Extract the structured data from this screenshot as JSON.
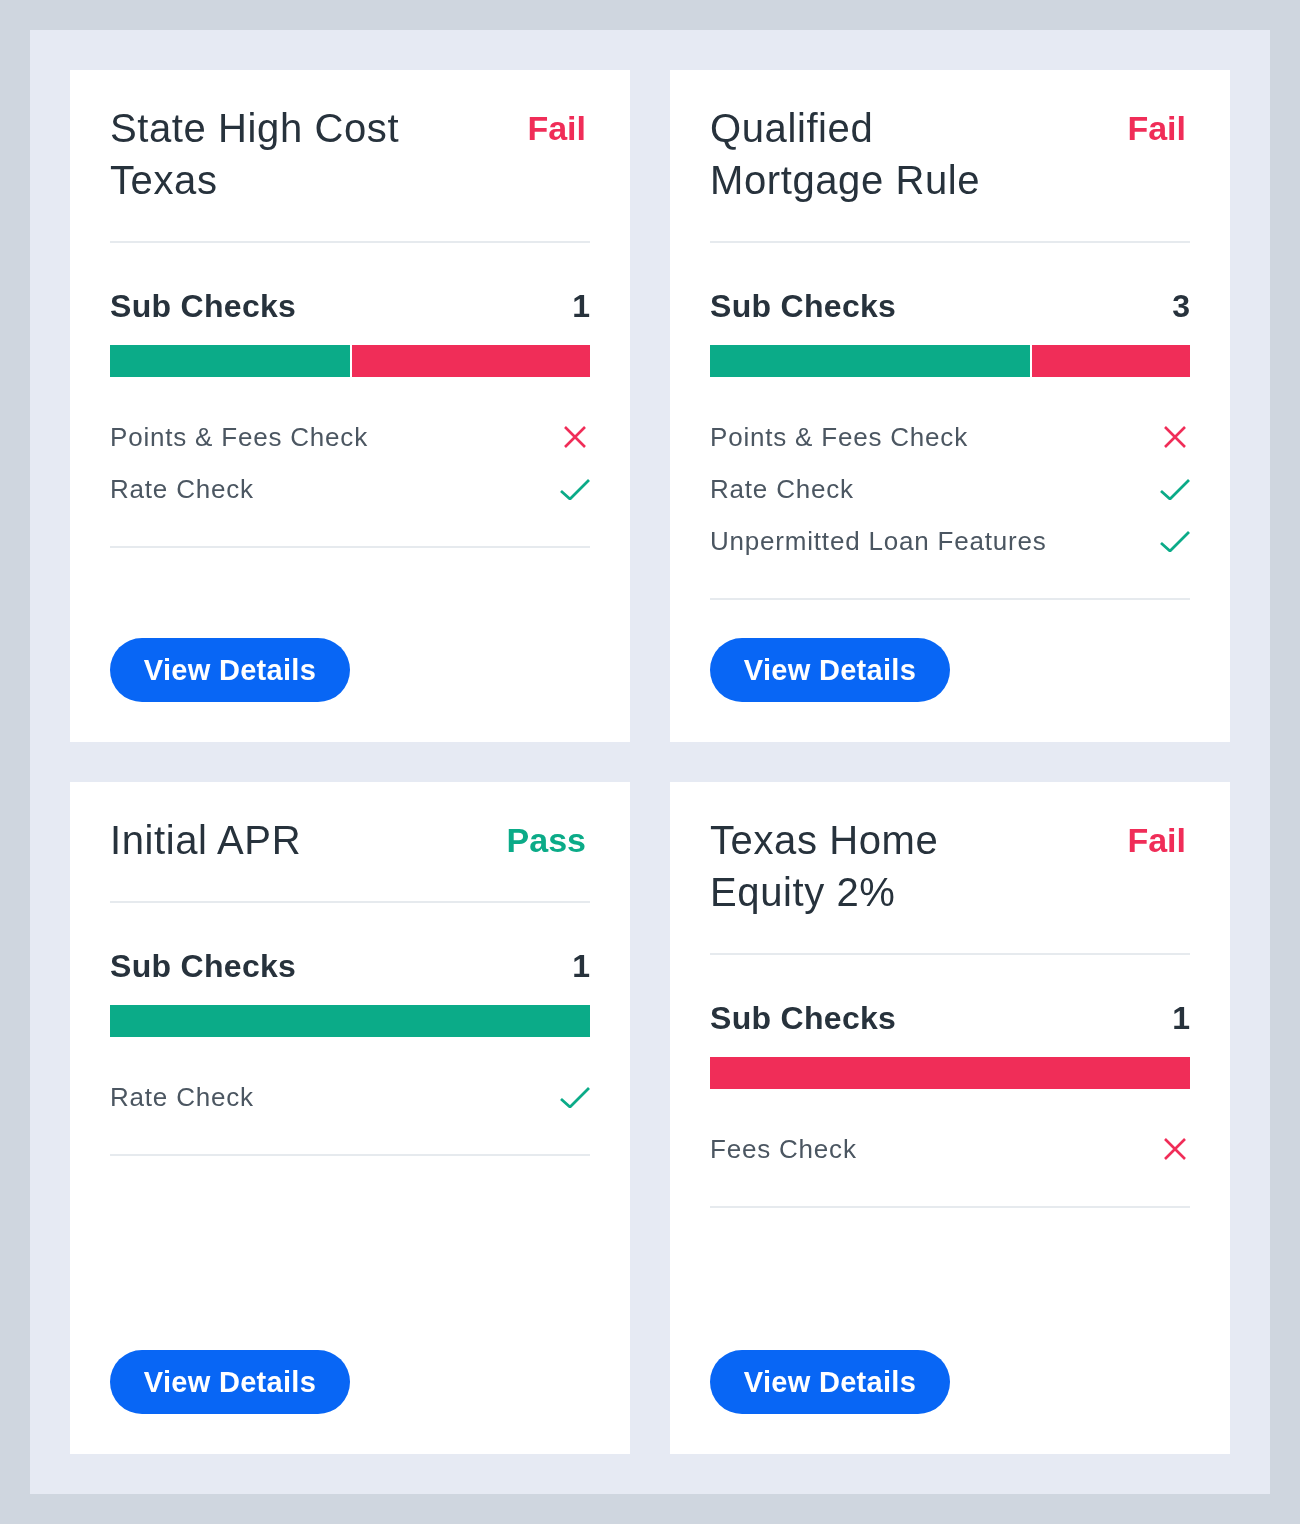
{
  "cards": [
    {
      "title": "State High Cost Texas",
      "status": {
        "label": "Fail",
        "passed": false
      },
      "sub_checks": {
        "label": "Sub Checks",
        "count": "1",
        "bar": {
          "level": 0.5
        },
        "items": [
          {
            "name": "Points & Fees Check",
            "passed": false
          },
          {
            "name": "Rate Check",
            "passed": true
          }
        ]
      },
      "button": "View Details"
    },
    {
      "title": "Qualified Mortgage Rule",
      "status": {
        "label": "Fail",
        "passed": false
      },
      "sub_checks": {
        "label": "Sub Checks",
        "count": "3",
        "bar": {
          "level": 0.667
        },
        "items": [
          {
            "name": "Points & Fees Check",
            "passed": false
          },
          {
            "name": "Rate Check",
            "passed": true
          },
          {
            "name": "Unpermitted Loan Features",
            "passed": true
          }
        ]
      },
      "button": "View Details"
    },
    {
      "title": "Initial APR",
      "status": {
        "label": "Pass",
        "passed": true
      },
      "sub_checks": {
        "label": "Sub Checks",
        "count": "1",
        "bar": {
          "level": 1
        },
        "items": [
          {
            "name": "Rate Check",
            "passed": true
          }
        ]
      },
      "button": "View Details"
    },
    {
      "title": "Texas Home Equity 2%",
      "status": {
        "label": "Fail",
        "passed": false
      },
      "sub_checks": {
        "label": "Sub Checks",
        "count": "1",
        "bar": {
          "level": 0
        },
        "items": [
          {
            "name": "Fees Check",
            "passed": false
          }
        ]
      },
      "button": "View Details"
    }
  ]
}
